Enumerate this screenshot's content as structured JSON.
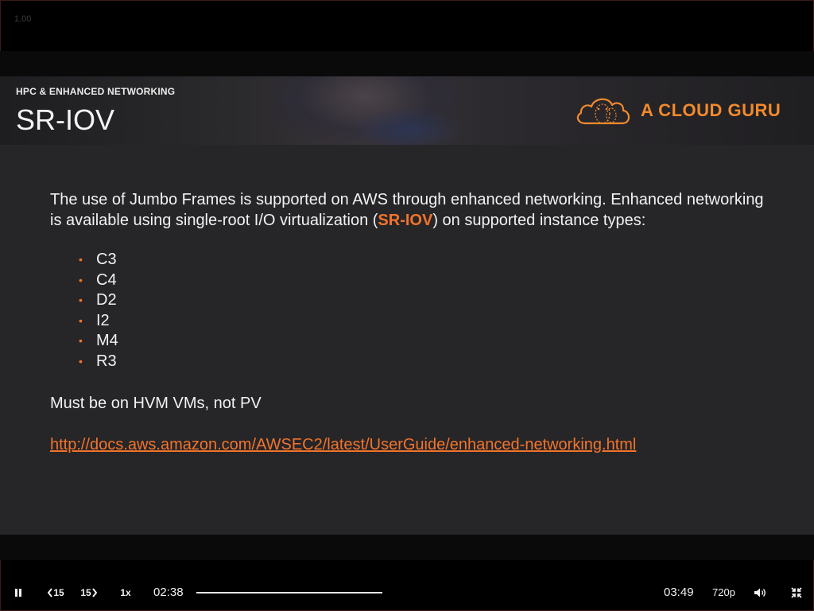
{
  "player": {
    "speed_readout": "1.00",
    "current_time": "02:38",
    "total_time": "03:49",
    "progress_fraction": 1.0,
    "playback_rate": "1x",
    "rewind_label": "15",
    "forward_label": "15",
    "quality": "720p"
  },
  "slide": {
    "section_label": "HPC & ENHANCED NETWORKING",
    "title": "SR-IOV",
    "logo_text": "A CLOUD GURU",
    "intro_part1": "The use of Jumbo Frames is supported on AWS through enhanced networking. Enhanced networking is available using single-root I/O virtualization (",
    "intro_highlight": "SR-IOV",
    "intro_part2": ") on supported instance types:",
    "instance_types": [
      "C3",
      "C4",
      "D2",
      "I2",
      "M4",
      "R3"
    ],
    "note": "Must be on HVM VMs, not PV",
    "link": "http://docs.aws.amazon.com/AWSEC2/latest/UserGuide/enhanced-networking.html"
  },
  "colors": {
    "accent": "#f2742a",
    "logo": "#f28a2c",
    "slide_bg": "#262528"
  }
}
